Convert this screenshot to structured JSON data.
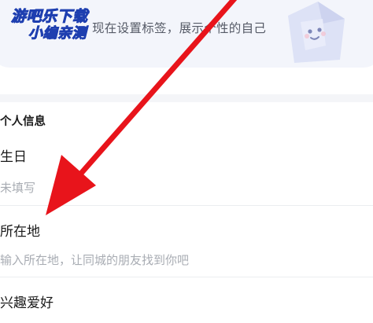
{
  "tag_card": {
    "text": "现在设置标签，展示个性的自己"
  },
  "watermark": {
    "line1": "游吧乐下载",
    "line2": "小编亲测"
  },
  "personal_info": {
    "section_title": "个人信息",
    "birthday": {
      "label": "生日",
      "value": "未填写"
    },
    "location": {
      "label": "所在地",
      "placeholder": "输入所在地，让同城的朋友找到你吧"
    },
    "hobbies": {
      "label": "兴趣爱好"
    }
  },
  "colors": {
    "arrow": "#e8141b",
    "watermark_fill": "#1ec8f0",
    "watermark_stroke": "#1e3fb0",
    "card_bg": "#f3f5fb"
  }
}
